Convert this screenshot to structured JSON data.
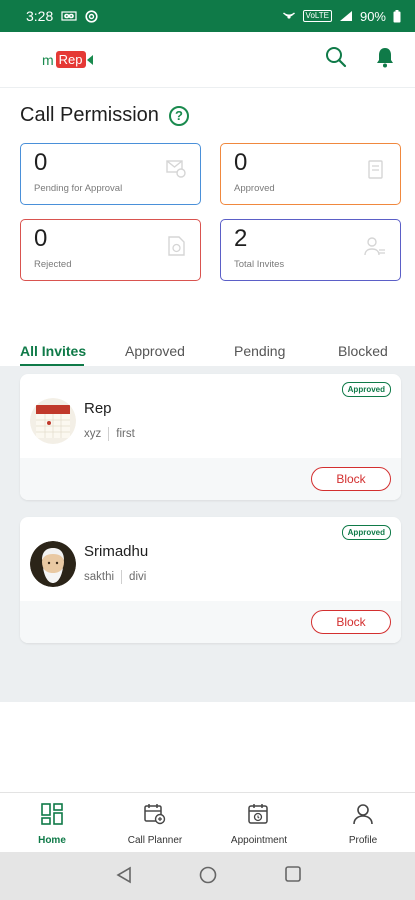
{
  "status_bar": {
    "time": "3:28",
    "network_label": "VoLTE",
    "battery": "90%"
  },
  "header": {
    "logo_m": "m",
    "logo_rep": "Rep"
  },
  "page": {
    "title": "Call Permission"
  },
  "stats": [
    {
      "value": "0",
      "label": "Pending for Approval",
      "color": "#4a90d9"
    },
    {
      "value": "0",
      "label": "Approved",
      "color": "#f0883e"
    },
    {
      "value": "0",
      "label": "Rejected",
      "color": "#d9534f"
    },
    {
      "value": "2",
      "label": "Total Invites",
      "color": "#5b5fc7"
    }
  ],
  "tabs": [
    {
      "label": "All Invites",
      "active": true
    },
    {
      "label": "Approved",
      "active": false
    },
    {
      "label": "Pending",
      "active": false
    },
    {
      "label": "Blocked",
      "active": false
    }
  ],
  "invites": [
    {
      "name": "Rep",
      "meta_1": "xyz",
      "meta_2": "first",
      "status": "Approved",
      "action": "Block"
    },
    {
      "name": "Srimadhu",
      "meta_1": "sakthi",
      "meta_2": "divi",
      "status": "Approved",
      "action": "Block"
    }
  ],
  "bottom_nav": [
    {
      "label": "Home",
      "icon": "home-grid-icon",
      "active": true
    },
    {
      "label": "Call Planner",
      "icon": "calendar-planner-icon",
      "active": false
    },
    {
      "label": "Appointment",
      "icon": "calendar-clock-icon",
      "active": false
    },
    {
      "label": "Profile",
      "icon": "person-icon",
      "active": false
    }
  ],
  "colors": {
    "brand_green": "#0f7a48",
    "danger_red": "#d32f2f"
  }
}
